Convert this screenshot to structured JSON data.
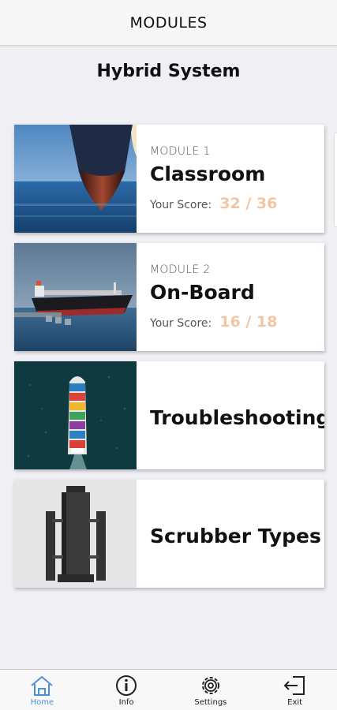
{
  "header": {
    "title": "MODULES"
  },
  "page": {
    "subtitle": "Hybrid System"
  },
  "modules": [
    {
      "label": "MODULE 1",
      "title": "Classroom",
      "score_label": "Your Score:",
      "score": "32 / 36",
      "image": "ship-bow-photo"
    },
    {
      "label": "MODULE 2",
      "title": "On-Board",
      "score_label": "Your Score:",
      "score": "16 / 18",
      "image": "tanker-ship-photo"
    },
    {
      "title": "Troubleshooting",
      "image": "container-ship-aerial-photo"
    },
    {
      "title": "Scrubber Types",
      "image": "scrubber-unit-photo"
    }
  ],
  "tabbar": {
    "items": [
      {
        "label": "Home",
        "icon": "home-icon",
        "active": true
      },
      {
        "label": "Info",
        "icon": "info-icon",
        "active": false
      },
      {
        "label": "Settings",
        "icon": "gear-icon",
        "active": false
      },
      {
        "label": "Exit",
        "icon": "exit-icon",
        "active": false
      }
    ]
  },
  "colors": {
    "score": "#f0c7a6",
    "active_tab": "#4a90d9",
    "background": "#efeff4"
  }
}
